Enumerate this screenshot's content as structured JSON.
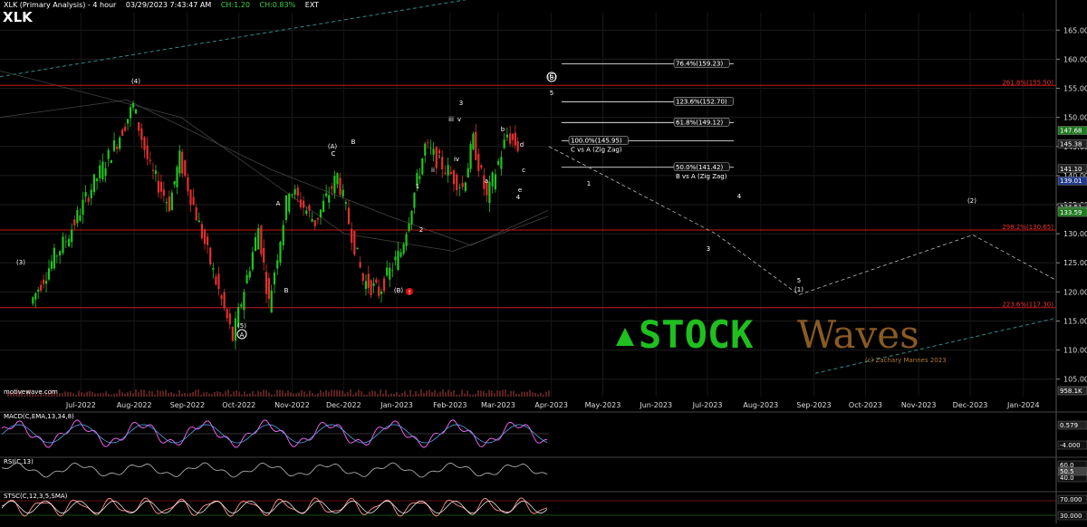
{
  "header": {
    "title": "XLK (Primary Analysis) - 4 hour",
    "datetime": "03/29/2023 7:43:47 AM",
    "ch": "CH:1.20",
    "chpct": "CH:0.83%",
    "ext": "EXT",
    "ticker": "XLK",
    "source": "motivewave.com"
  },
  "watermark": {
    "text": "STOCK",
    "text2": "Waves",
    "credit": "(c) Zachary Mannes 2023",
    "green": "#1fbf1f",
    "brown": "#8a5a24"
  },
  "chart_data": [
    {
      "type": "line",
      "name": "XLK price (4 hour candles)",
      "x_labels": [
        "Jul-2022",
        "Aug-2022",
        "Sep-2022",
        "Oct-2022",
        "Nov-2022",
        "Dec-2022",
        "Jan-2023",
        "Feb-2023",
        "Mar-2023",
        "Apr-2023",
        "May-2023",
        "Jun-2023",
        "Jul-2023",
        "Aug-2023",
        "Sep-2023",
        "Oct-2023",
        "Nov-2023",
        "Dec-2023",
        "Jan-2024"
      ],
      "y_ticks": [
        "165.00",
        "160.00",
        "155.00",
        "150.00",
        "145.00",
        "140.00",
        "135.00",
        "130.00",
        "125.00",
        "120.00",
        "115.00",
        "110.00",
        "105.00"
      ],
      "ylim": [
        102,
        168
      ],
      "price_path": [
        [
          "2022-06-17",
          118
        ],
        [
          "2022-07-01",
          126
        ],
        [
          "2022-07-08",
          129
        ],
        [
          "2022-07-21",
          137
        ],
        [
          "2022-08-05",
          145
        ],
        [
          "2022-08-16",
          152
        ],
        [
          "2022-08-26",
          141
        ],
        [
          "2022-09-06",
          135
        ],
        [
          "2022-09-12",
          143
        ],
        [
          "2022-09-30",
          125
        ],
        [
          "2022-10-13",
          112
        ],
        [
          "2022-10-28",
          131
        ],
        [
          "2022-11-03",
          118
        ],
        [
          "2022-11-15",
          138
        ],
        [
          "2022-11-30",
          132
        ],
        [
          "2022-12-13",
          140
        ],
        [
          "2022-12-28",
          122
        ],
        [
          "2023-01-06",
          120
        ],
        [
          "2023-01-19",
          127
        ],
        [
          "2023-02-02",
          145
        ],
        [
          "2023-02-24",
          138
        ],
        [
          "2023-03-02",
          146
        ],
        [
          "2023-03-10",
          136
        ],
        [
          "2023-03-22",
          147
        ],
        [
          "2023-03-28",
          145
        ]
      ],
      "price_labels": [
        {
          "value": 159.23,
          "label": "76.4%(159.23)"
        },
        {
          "value": 152.7,
          "label": "123.6%(152.70)"
        },
        {
          "value": 149.12,
          "label": "61.8%(149.12)"
        },
        {
          "value": 145.95,
          "label": "100.0%(145.95)",
          "sub": "C vs A (Zig Zag)"
        },
        {
          "value": 141.42,
          "label": "50.0%(141.42)",
          "sub": "B vs A (Zig Zag)"
        }
      ],
      "red_lines": [
        {
          "value": 155.5,
          "label": "261.8%(155.50)"
        },
        {
          "value": 130.65,
          "label": "298.2%(130.65)"
        },
        {
          "value": 117.3,
          "label": "223.6%(117.30)"
        }
      ],
      "right_tags": [
        "147.68",
        "145.38",
        "141.10",
        "139.01",
        "134.51",
        "133.84",
        "133.59"
      ],
      "forecast_labels": [
        "1",
        "2",
        "3",
        "4",
        "5",
        "(1)",
        "(2)"
      ],
      "wave_labels": [
        "(4)",
        "(3)",
        "(5)",
        "A",
        "B",
        "C",
        "(A)",
        "(B)",
        "(C)",
        "B",
        "1",
        "2",
        "3",
        "4",
        "5",
        "i",
        "ii",
        "iii",
        "iv",
        "v",
        "a",
        "b",
        "c",
        "d",
        "e"
      ]
    },
    {
      "type": "line",
      "name": "MACD(C,EMA,13,34,8)",
      "y_ticks": [
        "0.579",
        "-4.000"
      ],
      "color": "#ff66ff"
    },
    {
      "type": "line",
      "name": "RSI(C,13)",
      "y_ticks": [
        "60.0",
        "40.0",
        "50.5"
      ]
    },
    {
      "type": "line",
      "name": "STSC(C,12,3,5,SMA)",
      "y_ticks": [
        "70.000",
        "30.000"
      ],
      "color": "#ff8f8f"
    }
  ],
  "volume_label": "958.1K",
  "colors": {
    "bg": "#000000",
    "bull": "#22c322",
    "bear": "#e03030",
    "fib_line": "#ffffff",
    "red_line": "#c81818",
    "teal": "#2f8a8a"
  }
}
